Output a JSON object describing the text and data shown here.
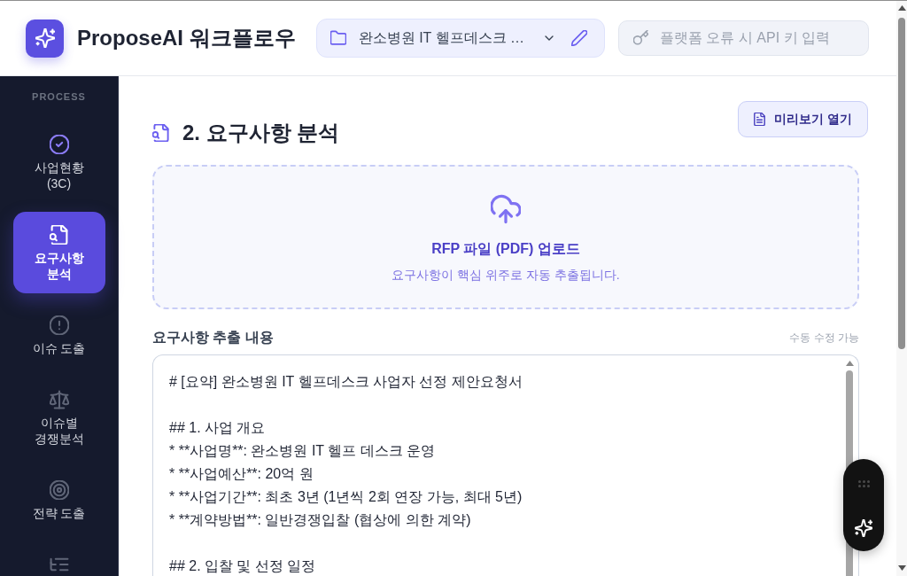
{
  "header": {
    "app_title": "ProposeAI 워크플로우",
    "project_select": {
      "value": "완소병원 IT 헬프데스크 …"
    },
    "api_key_field": {
      "placeholder": "플랫폼 오류 시 API 키 입력"
    }
  },
  "sidebar": {
    "section_label": "PROCESS",
    "items": [
      {
        "label": "사업현황 (3C)",
        "selected": false,
        "done": true
      },
      {
        "label": "요구사항 분석",
        "selected": true,
        "done": false
      },
      {
        "label": "이슈 도출",
        "selected": false,
        "done": false
      },
      {
        "label": "이슈별 경쟁분석",
        "selected": false,
        "done": false
      },
      {
        "label": "전략 도출",
        "selected": false,
        "done": false
      },
      {
        "selected": false,
        "done": false
      }
    ]
  },
  "main": {
    "title": "2. 요구사항 분석",
    "preview_button": "미리보기 열기",
    "upload": {
      "title": "RFP 파일 (PDF) 업로드",
      "hint": "요구사항이 핵심 위주로 자동 추출됩니다."
    },
    "extract": {
      "label": "요구사항 추출 내용",
      "note": "수동 수정 가능",
      "value": "# [요약] 완소병원 IT 헬프데스크 사업자 선정 제안요청서\n\n## 1. 사업 개요\n* **사업명**: 완소병원 IT 헬프 데스크 운영\n* **사업예산**: 20억 원\n* **사업기간**: 최초 3년 (1년씩 2회 연장 가능, 최대 5년)\n* **계약방법**: 일반경쟁입찰 (협상에 의한 계약)\n\n## 2. 입찰 및 선정 일정"
    }
  }
}
